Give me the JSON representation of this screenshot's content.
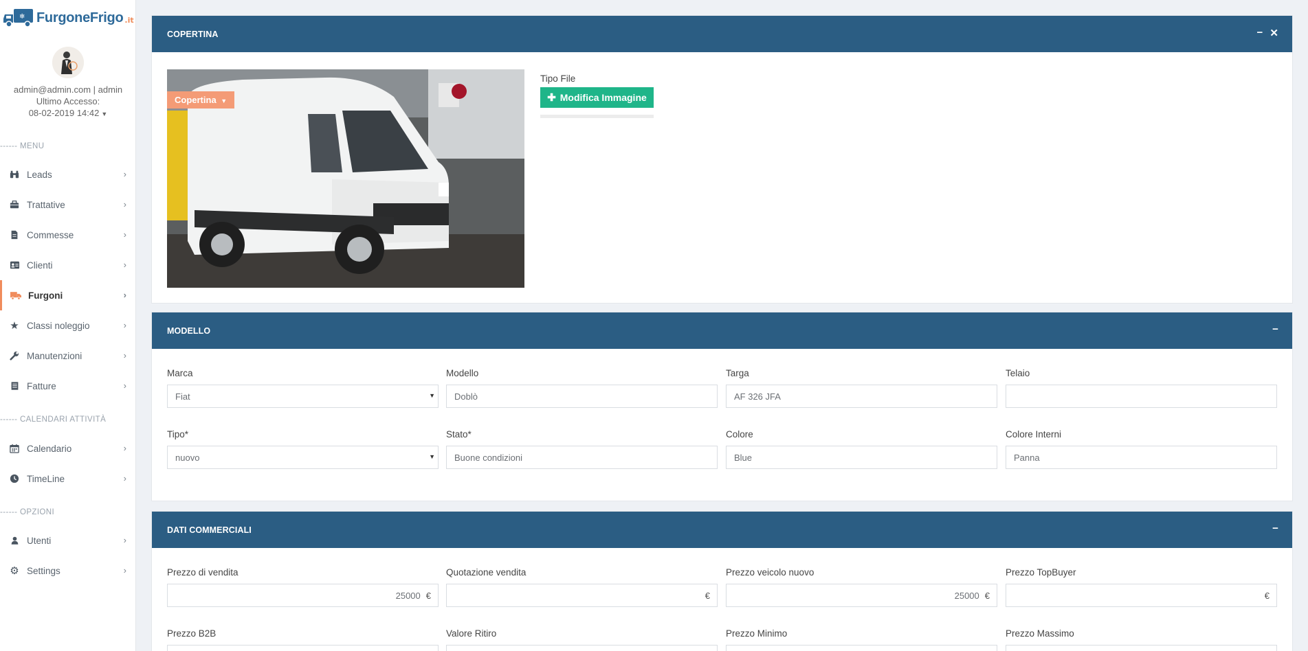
{
  "brand": {
    "name": "FurgoneFrigo",
    "tld": ".it"
  },
  "user": {
    "identity": "admin@admin.com | admin",
    "last_access_label": "Ultimo Accesso:",
    "last_access_value": "08-02-2019 14:42"
  },
  "sidebar": {
    "section_menu": "------ MENU",
    "section_calendars": "------ CALENDARI ATTIVITÀ",
    "section_options": "------ OPZIONI",
    "menu_items": [
      {
        "label": "Leads",
        "icon": "binoculars-icon"
      },
      {
        "label": "Trattative",
        "icon": "briefcase-icon"
      },
      {
        "label": "Commesse",
        "icon": "file-icon"
      },
      {
        "label": "Clienti",
        "icon": "id-card-icon"
      },
      {
        "label": "Furgoni",
        "icon": "truck-icon",
        "active": true
      },
      {
        "label": "Classi noleggio",
        "icon": "star-icon"
      },
      {
        "label": "Manutenzioni",
        "icon": "wrench-icon"
      },
      {
        "label": "Fatture",
        "icon": "list-alt-icon"
      }
    ],
    "calendar_items": [
      {
        "label": "Calendario",
        "icon": "calendar-icon"
      },
      {
        "label": "TimeLine",
        "icon": "clock-icon"
      }
    ],
    "option_items": [
      {
        "label": "Utenti",
        "icon": "user-icon"
      },
      {
        "label": "Settings",
        "icon": "gear-icon"
      }
    ]
  },
  "copertina": {
    "title": "COPERTINA",
    "cover_dropdown": "Copertina",
    "file_type_label": "Tipo File",
    "edit_button": "Modifica Immagine",
    "upload_progress": 0
  },
  "modello": {
    "title": "MODELLO",
    "marca": {
      "label": "Marca",
      "value": "Fiat"
    },
    "modello": {
      "label": "Modello",
      "value": "Doblò"
    },
    "targa": {
      "label": "Targa",
      "value": "AF 326 JFA"
    },
    "telaio": {
      "label": "Telaio",
      "value": ""
    },
    "tipo": {
      "label": "Tipo*",
      "value": "nuovo"
    },
    "stato": {
      "label": "Stato*",
      "value": "Buone condizioni"
    },
    "colore": {
      "label": "Colore",
      "value": "Blue"
    },
    "colore_interni": {
      "label": "Colore Interni",
      "value": "Panna"
    }
  },
  "dati_commerciali": {
    "title": "DATI COMMERCIALI",
    "currency": "€",
    "prezzo_vendita": {
      "label": "Prezzo di vendita",
      "value": "25000"
    },
    "quotazione_vendita": {
      "label": "Quotazione vendita",
      "value": ""
    },
    "prezzo_nuovo": {
      "label": "Prezzo veicolo nuovo",
      "value": "25000"
    },
    "prezzo_topbuyer": {
      "label": "Prezzo TopBuyer",
      "value": ""
    },
    "prezzo_b2b": {
      "label": "Prezzo B2B"
    },
    "valore_ritiro": {
      "label": "Valore Ritiro"
    },
    "prezzo_minimo": {
      "label": "Prezzo Minimo"
    },
    "prezzo_massimo": {
      "label": "Prezzo Massimo"
    }
  },
  "colors": {
    "header": "#2b5d83",
    "accent": "#f08c5c",
    "success": "#1fb589"
  }
}
